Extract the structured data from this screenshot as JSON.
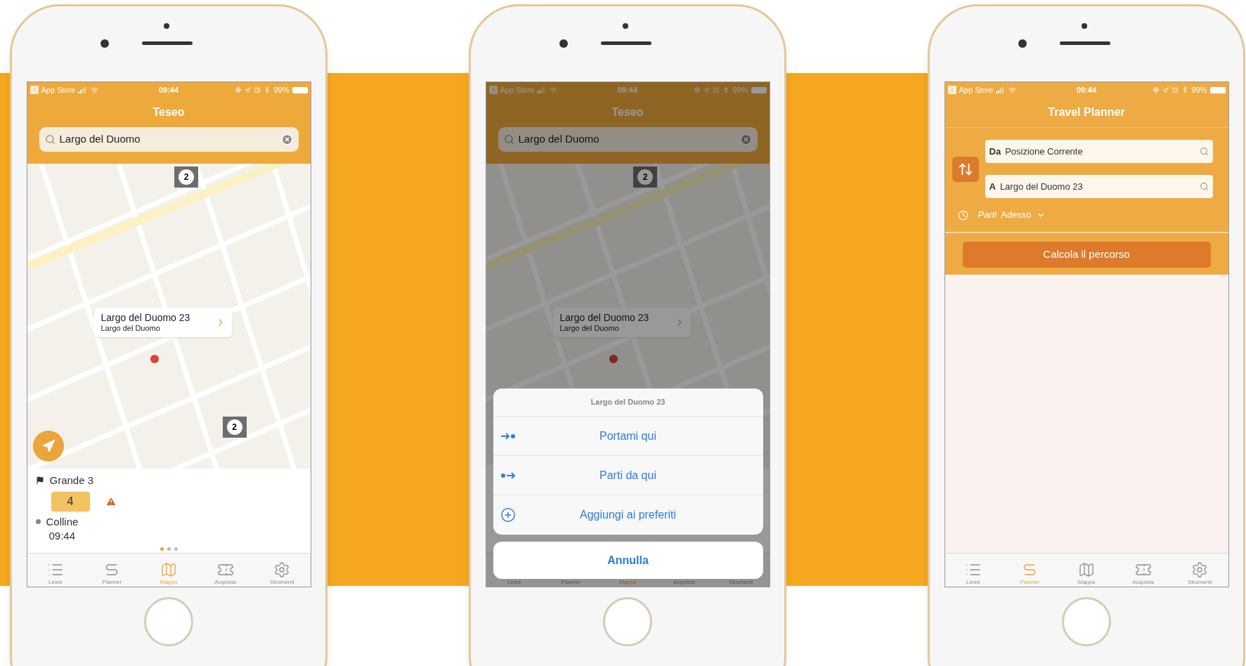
{
  "screens": [
    {
      "kind": "map",
      "dimmed": false,
      "status_bar": {
        "back": "App Store",
        "time": "09:44",
        "battery": "99%"
      },
      "title": "Teseo",
      "search": {
        "value": "Largo del Duomo"
      },
      "map": {
        "clusters": [
          "2",
          "2"
        ],
        "callout": {
          "title": "Largo del Duomo 23",
          "subtitle": "Largo del Duomo"
        },
        "locate_button": true
      },
      "panel": {
        "stop": "Grande 3",
        "line": "4",
        "warning": true,
        "destination": "Colline",
        "time": "09:44",
        "page_dots": [
          {
            "selected": true
          },
          {
            "selected": false
          },
          {
            "selected": false
          }
        ]
      },
      "tabs": [
        {
          "kind": "list",
          "label": "Linee",
          "selected": false
        },
        {
          "kind": "route",
          "label": "Planner",
          "selected": false
        },
        {
          "kind": "map",
          "label": "Mappa",
          "selected": true
        },
        {
          "kind": "ticket",
          "label": "Acquista",
          "selected": false
        },
        {
          "kind": "gear",
          "label": "Strumenti",
          "selected": false
        }
      ]
    },
    {
      "kind": "map",
      "dimmed": true,
      "status_bar": {
        "back": "App Store",
        "time": "09:44",
        "battery": "99%"
      },
      "title": "Teseo",
      "search": {
        "value": "Largo del Duomo"
      },
      "map": {
        "clusters": [
          "2"
        ],
        "callout": {
          "title": "Largo del Duomo 23",
          "subtitle": "Largo del Duomo"
        },
        "locate_button": false
      },
      "action_sheet": {
        "title": "Largo del Duomo 23",
        "actions": [
          {
            "kind": "to",
            "label": "Portami qui"
          },
          {
            "kind": "from",
            "label": "Parti da qui"
          },
          {
            "kind": "add",
            "label": "Aggiungi ai preferiti"
          }
        ],
        "cancel": "Annulla"
      },
      "tabs": [
        {
          "label": "Linee",
          "selected": false
        },
        {
          "label": "Planner",
          "selected": false
        },
        {
          "label": "Mappa",
          "selected": true
        },
        {
          "label": "Acquista",
          "selected": false
        },
        {
          "label": "Strumenti",
          "selected": false
        }
      ]
    },
    {
      "kind": "planner",
      "status_bar": {
        "back": "App Store",
        "time": "09:44",
        "battery": "99%"
      },
      "title": "Travel Planner",
      "from": {
        "prefix": "Da",
        "value": "Posizione Corrente"
      },
      "to": {
        "prefix": "A",
        "value": "Largo del Duomo 23"
      },
      "when": {
        "label": "Parti",
        "value": "Adesso"
      },
      "button": "Calcola il percorso",
      "tabs": [
        {
          "kind": "list",
          "label": "Linee",
          "selected": false
        },
        {
          "kind": "route",
          "label": "Planner",
          "selected": true
        },
        {
          "kind": "map",
          "label": "Mappa",
          "selected": false
        },
        {
          "kind": "ticket",
          "label": "Acquista",
          "selected": false
        },
        {
          "kind": "gear",
          "label": "Strumenti",
          "selected": false
        }
      ]
    }
  ]
}
